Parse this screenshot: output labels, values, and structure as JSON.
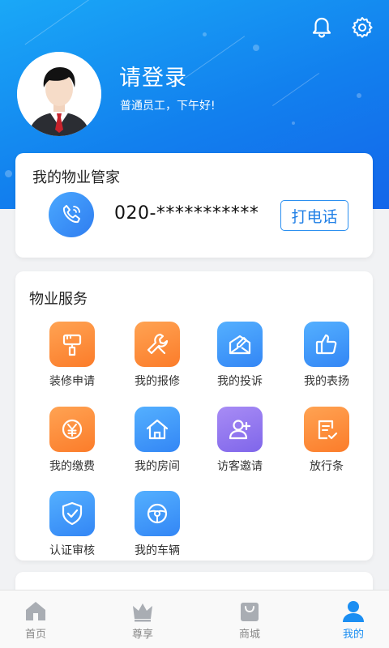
{
  "header": {
    "login_title": "请登录",
    "greeting": "普通员工，下午好!",
    "icons": [
      "bell-icon",
      "gear-icon"
    ]
  },
  "manager": {
    "title": "我的物业管家",
    "phone": "020-***********",
    "call_label": "打电话"
  },
  "services": {
    "title": "物业服务",
    "items": [
      {
        "label": "装修申请",
        "icon": "paint-brush-icon",
        "color": "orange"
      },
      {
        "label": "我的报修",
        "icon": "wrench-icon",
        "color": "orange"
      },
      {
        "label": "我的投诉",
        "icon": "envelope-edit-icon",
        "color": "blue"
      },
      {
        "label": "我的表扬",
        "icon": "thumbs-up-icon",
        "color": "blue"
      },
      {
        "label": "我的缴费",
        "icon": "yuan-payment-icon",
        "color": "orange"
      },
      {
        "label": "我的房间",
        "icon": "house-icon",
        "color": "blue"
      },
      {
        "label": "访客邀请",
        "icon": "add-user-icon",
        "color": "purple"
      },
      {
        "label": "放行条",
        "icon": "pass-note-icon",
        "color": "orange"
      },
      {
        "label": "认证审核",
        "icon": "shield-check-icon",
        "color": "blue"
      },
      {
        "label": "我的车辆",
        "icon": "steering-wheel-icon",
        "color": "blue"
      }
    ]
  },
  "tabbar": {
    "tabs": [
      {
        "label": "首页",
        "icon": "home-icon"
      },
      {
        "label": "尊享",
        "icon": "crown-icon"
      },
      {
        "label": "商城",
        "icon": "shopping-bag-icon"
      },
      {
        "label": "我的",
        "icon": "person-icon"
      }
    ],
    "active_index": 3
  },
  "colors": {
    "header_blue": "#1280ee",
    "accent_blue": "#1b8ef2",
    "orange": "#fb7c2a",
    "purple": "#7f66ea"
  }
}
